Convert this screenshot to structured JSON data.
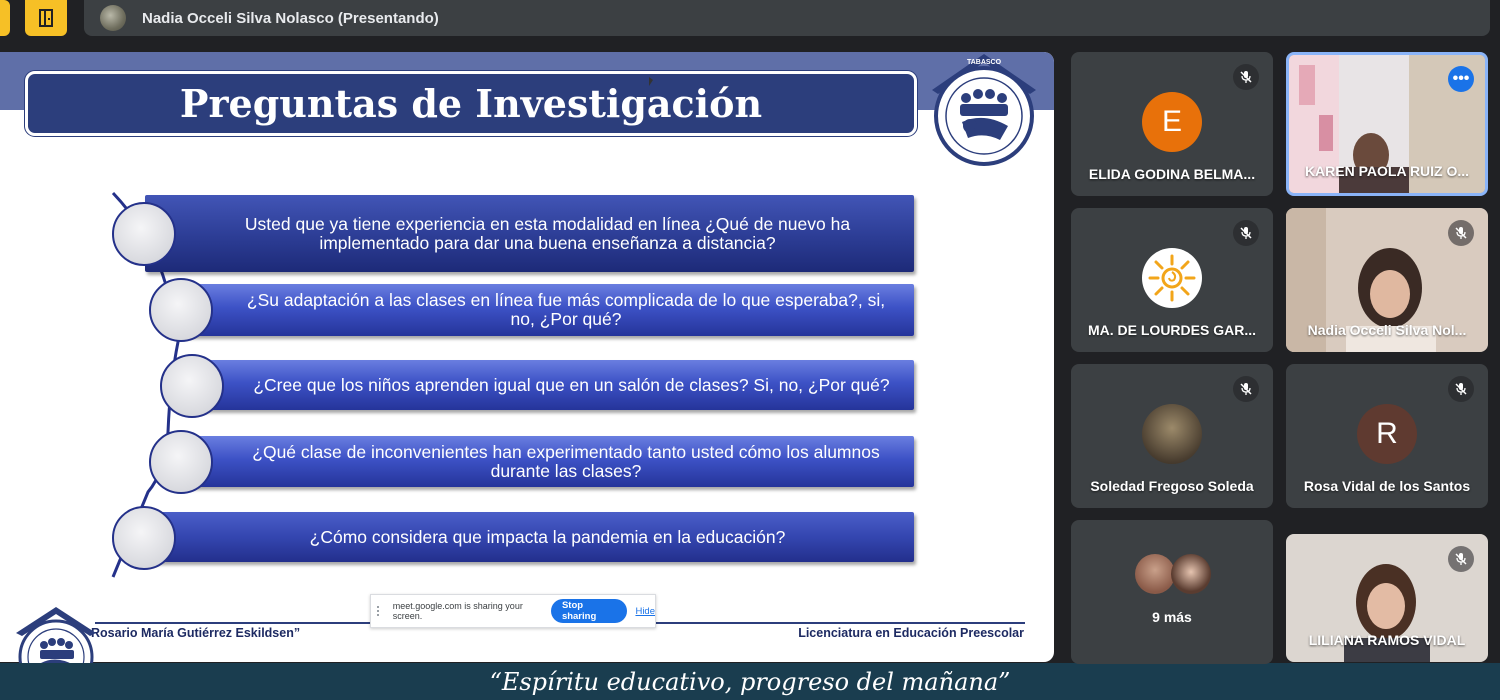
{
  "presenter": {
    "name": "Nadia Occeli Silva Nolasco (Presentando)"
  },
  "slide": {
    "title": "Preguntas de Investigación",
    "questions": [
      "Usted que ya tiene experiencia en esta modalidad en línea ¿Qué de nuevo ha implementado para dar una buena enseñanza a distancia?",
      "¿Su adaptación a las clases en línea fue más complicada de lo que esperaba?, si, no, ¿Por qué?",
      "¿Cree que los niños aprenden igual que en un salón de clases? Si, no, ¿Por qué?",
      "¿Qué clase de inconvenientes han experimentado tanto usted cómo los alumnos durante las clases?",
      "¿Cómo considera que impacta la pandemia en la educación?"
    ],
    "footer_left": "Rosario María Gutiérrez Eskildsen”",
    "footer_right": "Licenciatura en Educación Preescolar",
    "logo_text": "TABASCO"
  },
  "share_bar": {
    "message": "meet.google.com is sharing your screen.",
    "stop_label": "Stop sharing",
    "hide_label": "Hide"
  },
  "banner": {
    "text": "“Espíritu educativo, progreso del mañana”"
  },
  "participants": [
    {
      "name": "ELIDA GODINA BELMA...",
      "initial": "E",
      "avatar_color": "#e8710a"
    },
    {
      "name": "KAREN PAOLA RUIZ O..."
    },
    {
      "name": "MA. DE LOURDES GAR..."
    },
    {
      "name": "Nadia Occeli Silva Nol..."
    },
    {
      "name": "Soledad Fregoso Soleda"
    },
    {
      "name": "Rosa Vidal de los Santos",
      "initial": "R",
      "avatar_color": "#5f3a30"
    },
    {
      "more_label": "9 más"
    },
    {
      "name": "LILIANA RAMOS VIDAL"
    }
  ],
  "colors": {
    "accent": "#1a73e8",
    "slide_navy": "#2c3e7c",
    "banner": "#1a3d4f",
    "tile": "#3c4043"
  }
}
